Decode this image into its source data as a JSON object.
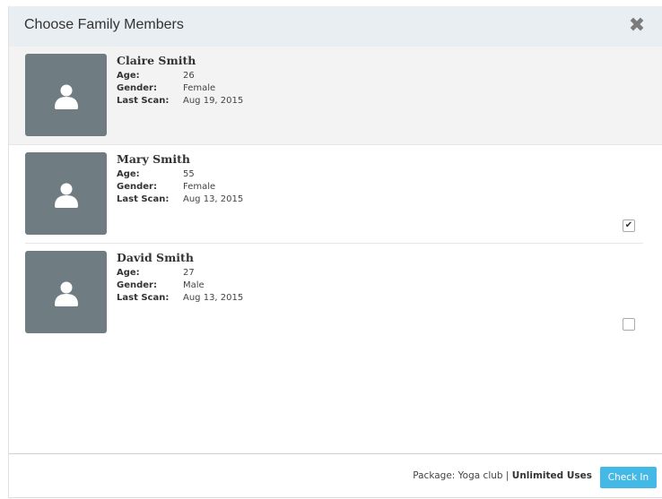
{
  "dialog": {
    "title": "Choose Family Members",
    "close_icon": "close-icon"
  },
  "labels": {
    "age": "Age:",
    "gender": "Gender:",
    "last_scan": "Last Scan:"
  },
  "members": [
    {
      "name": "Claire Smith",
      "age": "26",
      "gender": "Female",
      "last_scan": "Aug 19, 2015",
      "checked": null
    },
    {
      "name": "Mary Smith",
      "age": "55",
      "gender": "Female",
      "last_scan": "Aug 13, 2015",
      "checked": true
    },
    {
      "name": "David Smith",
      "age": "27",
      "gender": "Male",
      "last_scan": "Aug 13, 2015",
      "checked": false
    }
  ],
  "footer": {
    "package_prefix": "Package: Yoga club",
    "separator": "|",
    "package_plan": "Unlimited Uses",
    "checkin_label": "Check In"
  },
  "colors": {
    "header_bg": "#e8eef2",
    "avatar_bg": "#6f7d83",
    "accent": "#45b9e6"
  }
}
